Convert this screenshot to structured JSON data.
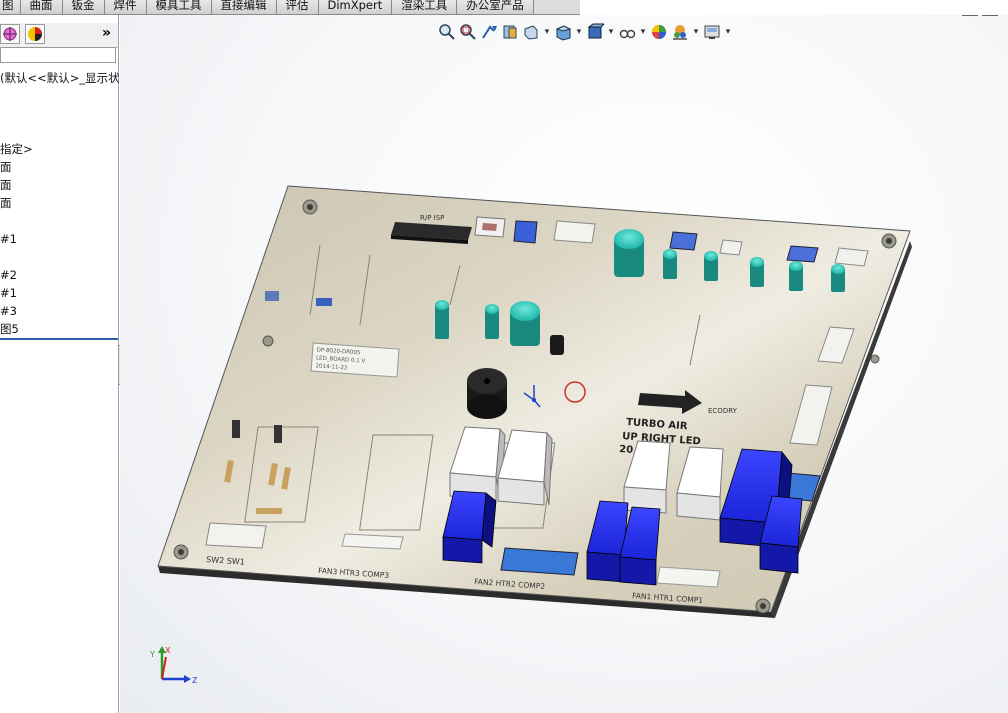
{
  "ribbon": {
    "tabs": [
      "图",
      "曲面",
      "钣金",
      "焊件",
      "模具工具",
      "直接编辑",
      "评估",
      "DimXpert",
      "渲染工具",
      "办公室产品"
    ]
  },
  "panel": {
    "expand_label": "»",
    "tree_items": [
      "(默认<<默认>_显示状",
      "指定>",
      "面",
      "面",
      "面",
      "#1",
      "#2",
      "#1",
      "#3",
      "图5"
    ]
  },
  "board": {
    "silkscreen": {
      "rp_label": "R/P  ISP",
      "turbo": "TURBO  AIR",
      "up_right": "UP  RIGHT  LED",
      "year": "20",
      "brand": "ECODRY",
      "sw_label": "SW2  SW1",
      "connector_left": "FAN3 HTR3 COMP3",
      "connector_mid": "FAN2 HTR2 COMP2",
      "connector_right": "FAN1 HTR1 COMP1",
      "sticker_line1": "DP-8020-DR005",
      "sticker_line2": "LED_BOARD 0.1 V",
      "sticker_line3": "2014-11-22"
    }
  },
  "triad": {
    "x": "X",
    "y": "Y",
    "z": "Z"
  },
  "colors": {
    "relay_blue": "#1a24d8",
    "capacitor_teal": "#1fb5a8",
    "board_tan": "#d8d2bf"
  }
}
